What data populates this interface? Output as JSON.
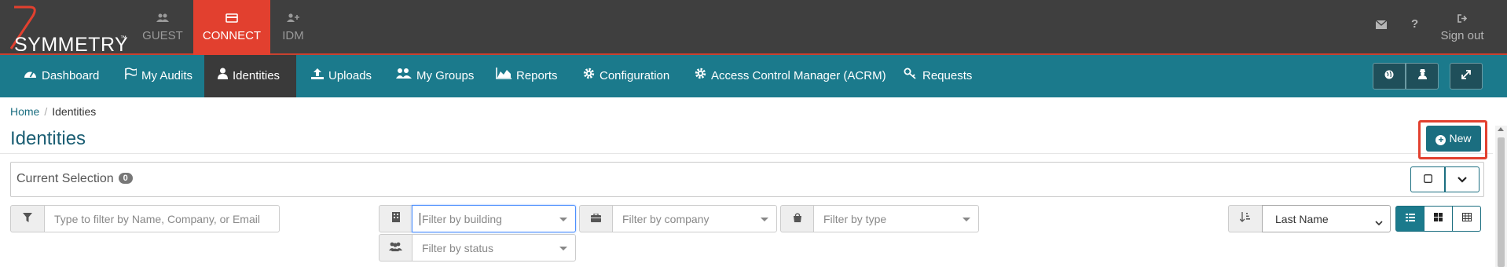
{
  "topbar": {
    "brand": "SYMMETRY",
    "trademark": "™",
    "apps": [
      {
        "label": "GUEST",
        "icon": "users-icon"
      },
      {
        "label": "CONNECT",
        "icon": "card-icon"
      },
      {
        "label": "IDM",
        "icon": "user-plus-icon"
      }
    ],
    "active_app": "CONNECT",
    "sign_out_label": "Sign out",
    "accent": "#e2402f"
  },
  "nav": {
    "items": [
      {
        "label": "Dashboard",
        "icon": "dashboard-icon"
      },
      {
        "label": "My Audits",
        "icon": "flag-icon"
      },
      {
        "label": "Identities",
        "icon": "user-icon"
      },
      {
        "label": "Uploads",
        "icon": "upload-icon"
      },
      {
        "label": "My Groups",
        "icon": "users-icon"
      },
      {
        "label": "Reports",
        "icon": "area-chart-icon"
      },
      {
        "label": "Configuration",
        "icon": "gear-icon"
      },
      {
        "label": "Access Control Manager (ACRM)",
        "icon": "gear-icon"
      },
      {
        "label": "Requests",
        "icon": "key-icon"
      }
    ],
    "active": "Identities",
    "color": "#1b7a8c"
  },
  "breadcrumb": {
    "home": "Home",
    "current": "Identities"
  },
  "page": {
    "title": "Identities",
    "new_button": "New"
  },
  "selection": {
    "label": "Current Selection",
    "count": "0"
  },
  "filters": {
    "text_placeholder": "Type to filter by Name, Company, or Email",
    "building_placeholder": "Filter by building",
    "company_placeholder": "Filter by company",
    "type_placeholder": "Filter by type",
    "status_placeholder": "Filter by status",
    "sort_value": "Last Name"
  }
}
